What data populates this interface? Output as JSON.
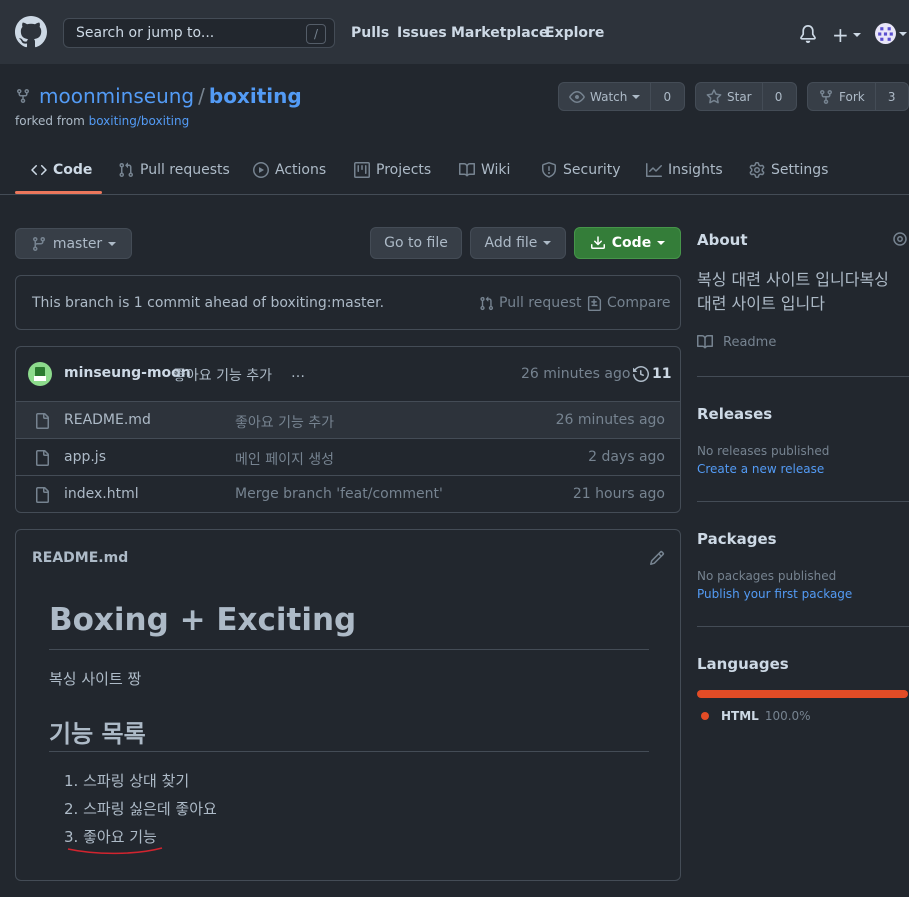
{
  "header": {
    "search_placeholder": "Search or jump to...",
    "search_key": "/",
    "nav": [
      "Pulls",
      "Issues",
      "Marketplace",
      "Explore"
    ],
    "plus": "+"
  },
  "repo": {
    "owner": "moonminseung",
    "separator": "/",
    "name": "boxiting",
    "forked_prefix": "forked from",
    "forked_link": "boxiting/boxiting",
    "watch_label": "Watch",
    "watch_count": "0",
    "star_label": "Star",
    "star_count": "0",
    "fork_label": "Fork",
    "fork_count": "3"
  },
  "tabs": [
    {
      "label": "Code"
    },
    {
      "label": "Pull requests"
    },
    {
      "label": "Actions"
    },
    {
      "label": "Projects"
    },
    {
      "label": "Wiki"
    },
    {
      "label": "Security"
    },
    {
      "label": "Insights"
    },
    {
      "label": "Settings"
    }
  ],
  "toolbar": {
    "branch": "master",
    "goto_file": "Go to file",
    "add_file": "Add file",
    "code": "Code"
  },
  "branch_info": {
    "message": "This branch is 1 commit ahead of boxiting:master.",
    "pull_request": "Pull request",
    "compare": "Compare"
  },
  "latest_commit": {
    "author": "minseung-moon",
    "message": "좋아요 기능 추가",
    "ellipsis": "…",
    "time": "26 minutes ago",
    "count": "11"
  },
  "files": [
    {
      "name": "README.md",
      "message": "좋아요 기능 추가",
      "date": "26 minutes ago"
    },
    {
      "name": "app.js",
      "message": "메인 페이지 생성",
      "date": "2 days ago"
    },
    {
      "name": "index.html",
      "message": "Merge branch 'feat/comment'",
      "date": "21 hours ago"
    }
  ],
  "readme": {
    "filename": "README.md",
    "h1": "Boxing + Exciting",
    "intro": "복싱 사이트 짱",
    "h2": "기능 목록",
    "list": [
      "스파링 상대 찾기",
      "스파링 싫은데 좋아요",
      "좋아요 기능"
    ]
  },
  "about": {
    "title": "About",
    "description": "복싱 대련 사이트 입니다복싱 대련 사이트 입니다",
    "readme": "Readme"
  },
  "releases": {
    "title": "Releases",
    "none": "No releases published",
    "link": "Create a new release"
  },
  "packages": {
    "title": "Packages",
    "none": "No packages published",
    "link": "Publish your first package"
  },
  "languages": {
    "title": "Languages",
    "items": [
      {
        "name": "HTML",
        "percent": "100.0%",
        "color": "#e34c26"
      }
    ]
  },
  "colors": {
    "accent_link": "#539bf5",
    "primary_button": "#347d39",
    "active_tab": "#ec775c",
    "annotation": "#d1242f"
  }
}
